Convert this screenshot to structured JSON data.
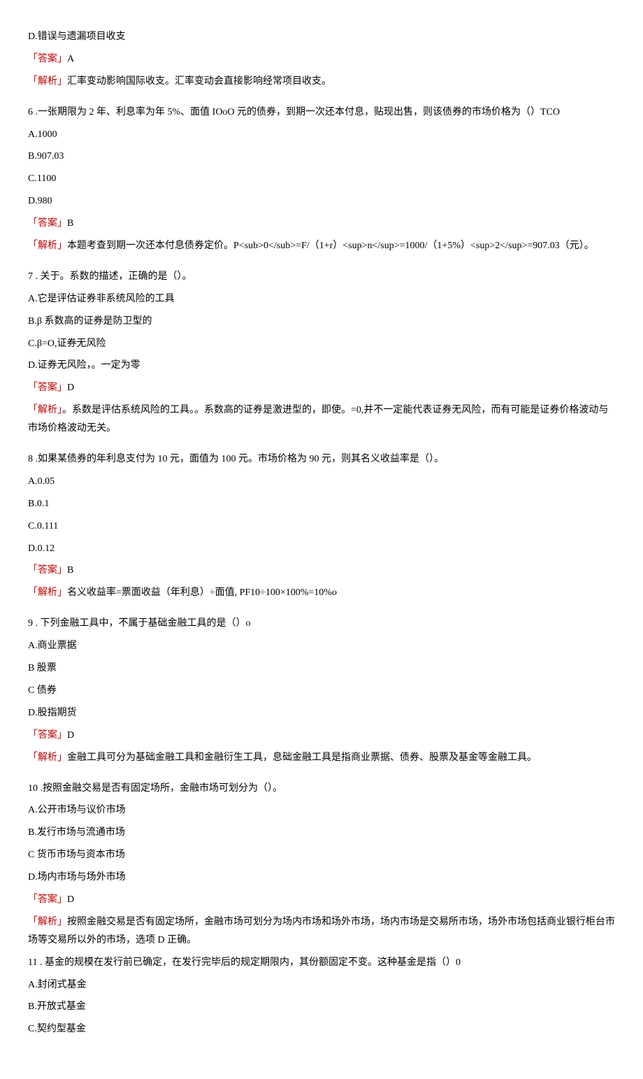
{
  "q5": {
    "optD": "D.错误与遗漏项目收支",
    "ansLabel": "「答案」",
    "ans": "A",
    "expLabel": "「解析」",
    "exp": "汇率变动影响国际收支。汇率变动会直接影响经常项目收支。"
  },
  "q6": {
    "stem": "6  .一张期限为 2 年、利息率为年 5%、面值 IOoO 元的债券，到期一次还本付息，贴现出售，则该债券的市场价格为（）TCO",
    "optA": "A.1000",
    "optB": "B.907.03",
    "optC": "C.1100",
    "optD": "D.980",
    "ansLabel": "「答案」",
    "ans": "B",
    "expLabel": "「解析」",
    "exp": "本题考查到期一次还本付息债券定价。P<sub>0</sub>=F/（1+r）<sup>n</sup>=1000/（1+5%）<sup>2</sup>=907.03（元）。"
  },
  "q7": {
    "stem": "7  . 关于。系数的描述，正确的是（）。",
    "optA": "A.它是评估证券非系统风险的工具",
    "optB": "B.β 系数高的证券是防卫型的",
    "optC": "C.β=O,证券无风险",
    "optD": "D.证券无风险，。一定为零",
    "ansLabel": "「答案」",
    "ans": "D",
    "expLabel": "「解析」",
    "exp": "。系数是评估系统风险的工具。。系数高的证券是激进型的，即使。=0,并不一定能代表证券无风险，而有可能是证券价格波动与市场价格波动无关。"
  },
  "q8": {
    "stem": "8  .如果某债券的年利息支付为 10 元，面值为 100 元。市场价格为 90 元，则其名义收益率是（）。",
    "optA": "A.0.05",
    "optB": "B.0.1",
    "optC": "C.0.111",
    "optD": "D.0.12",
    "ansLabel": "「答案」",
    "ans": "B",
    "expLabel": "「解析」",
    "exp": "名义收益率=票面收益（年利息）÷面值, PF10÷100×100%=10%o"
  },
  "q9": {
    "stem": "9  . 下列金融工具中，不属于基础金融工具的是（）o",
    "optA": "A.商业票据",
    "optB": "B 股票",
    "optC": "C 债券",
    "optD": "D.股指期货",
    "ansLabel": "「答案」",
    "ans": "D",
    "expLabel": "「解析」",
    "exp": "金融工具可分为基础金融工具和金融衍生工具，息础金融工具是指商业票据、债券、股票及基金等金融工具。"
  },
  "q10": {
    "stem": "10  .按照金融交易是否有固定场所，金融市场可划分为（）。",
    "optA": "A.公开市场与议价市场",
    "optB": "B.发行市场与流通市场",
    "optC": "C 货币市场与资本市场",
    "optD": "D.场内市场与场外市场",
    "ansLabel": "「答案」",
    "ans": "D",
    "expLabel": "「解析」",
    "exp": "按照金融交易是否有固定场所，金融市场可划分为场内市场和场外市场，场内市场是交易所市场，场外市场包括商业银行柜台市场等交易所以外的市场，选项 D 正确。"
  },
  "q11": {
    "stem": "11  . 基金的规模在发行前已确定，在发行完毕后的规定期限内，其份额固定不变。这种基金是指（）0",
    "optA": "A.封闭式基金",
    "optB": "B.开放式基金",
    "optC": "C.契约型基金"
  }
}
